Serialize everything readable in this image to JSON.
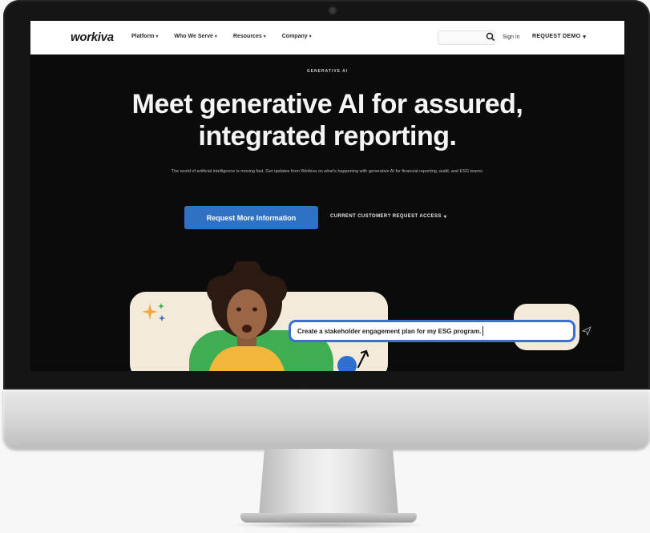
{
  "nav": {
    "logo": "workiva",
    "items": [
      {
        "label": "Platform",
        "icon": "chevron-down-icon"
      },
      {
        "label": "Who We Serve",
        "icon": "chevron-down-icon"
      },
      {
        "label": "Resources",
        "icon": "chevron-down-icon"
      },
      {
        "label": "Company",
        "icon": "chevron-down-icon"
      }
    ],
    "search_icon": "search-icon",
    "signin": "Sign in",
    "demo": "REQUEST DEMO",
    "demo_icon": "chevron-down-icon"
  },
  "hero": {
    "eyebrow": "GENERATIVE AI",
    "headline_line1": "Meet generative AI for assured,",
    "headline_line2": "integrated reporting.",
    "subtext": "The world of artificial intelligence is moving fast. Get updates from Workiva on what's happening with generative AI for financial reporting, audit, and ESG teams.",
    "cta_primary": "Request More Information",
    "cta_secondary": "CURRENT CUSTOMER? REQUEST ACCESS",
    "cta_secondary_icon": "chevron-down-icon",
    "prompt": "Create a stakeholder engagement plan for my ESG program."
  },
  "colors": {
    "screen_bg": "#0b0b0b",
    "primary_blue": "#2f72c4",
    "card_cream": "#f4ead9",
    "accent_green": "#3fae53"
  }
}
